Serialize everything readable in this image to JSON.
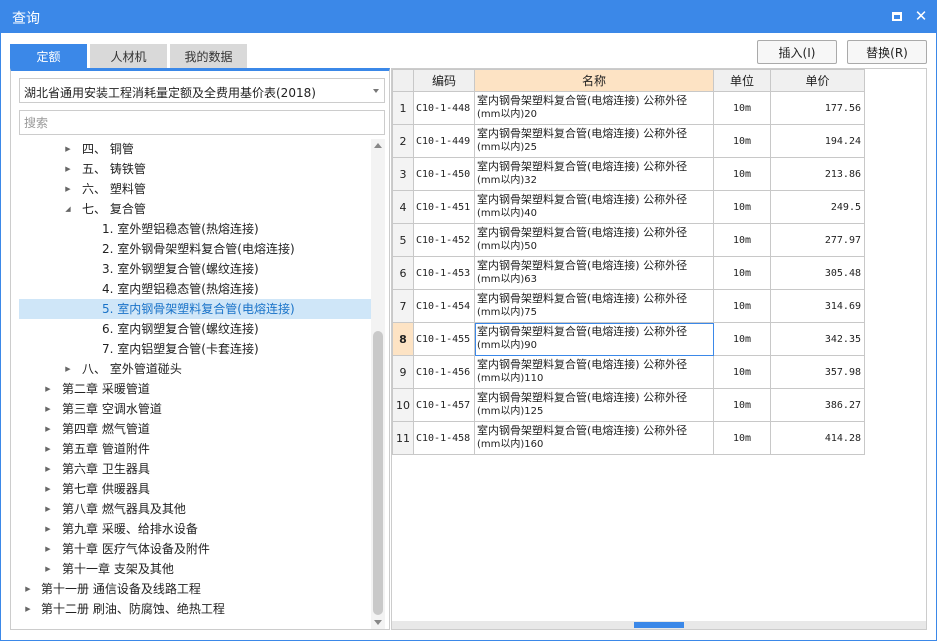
{
  "window": {
    "title": "查询"
  },
  "tabs": [
    {
      "label": "定额"
    },
    {
      "label": "人材机"
    },
    {
      "label": "我的数据"
    }
  ],
  "buttons": {
    "insert": "插入(I)",
    "replace": "替换(R)"
  },
  "left": {
    "library_select": "湖北省通用安装工程消耗量定额及全费用基价表(2018)",
    "search_placeholder": "搜索",
    "tree": [
      {
        "label": "四、 铜管",
        "level": 1,
        "expanded": false
      },
      {
        "label": "五、 铸铁管",
        "level": 1,
        "expanded": false
      },
      {
        "label": "六、 塑料管",
        "level": 1,
        "expanded": false
      },
      {
        "label": "七、 复合管",
        "level": 1,
        "expanded": true
      },
      {
        "label": "1. 室外塑铝稳态管(热熔连接)",
        "level": 2
      },
      {
        "label": "2. 室外钢骨架塑料复合管(电熔连接)",
        "level": 2
      },
      {
        "label": "3. 室外钢塑复合管(螺纹连接)",
        "level": 2
      },
      {
        "label": "4. 室内塑铝稳态管(热熔连接)",
        "level": 2
      },
      {
        "label": "5. 室内钢骨架塑料复合管(电熔连接)",
        "level": 2,
        "selected": true
      },
      {
        "label": "6. 室内钢塑复合管(螺纹连接)",
        "level": 2
      },
      {
        "label": "7. 室内铝塑复合管(卡套连接)",
        "level": 2
      },
      {
        "label": "八、 室外管道碰头",
        "level": 1,
        "expanded": false
      },
      {
        "label": "第二章 采暖管道",
        "level": 0,
        "expanded": false
      },
      {
        "label": "第三章 空调水管道",
        "level": 0,
        "expanded": false
      },
      {
        "label": "第四章 燃气管道",
        "level": 0,
        "expanded": false
      },
      {
        "label": "第五章 管道附件",
        "level": 0,
        "expanded": false
      },
      {
        "label": "第六章 卫生器具",
        "level": 0,
        "expanded": false
      },
      {
        "label": "第七章 供暖器具",
        "level": 0,
        "expanded": false
      },
      {
        "label": "第八章 燃气器具及其他",
        "level": 0,
        "expanded": false
      },
      {
        "label": "第九章 采暖、给排水设备",
        "level": 0,
        "expanded": false
      },
      {
        "label": "第十章 医疗气体设备及附件",
        "level": 0,
        "expanded": false
      },
      {
        "label": "第十一章 支架及其他",
        "level": 0,
        "expanded": false
      },
      {
        "label": "第十一册 通信设备及线路工程",
        "level": -1,
        "expanded": false
      },
      {
        "label": "第十二册 刷油、防腐蚀、绝热工程",
        "level": -1,
        "expanded": false
      }
    ]
  },
  "table": {
    "headers": {
      "code": "编码",
      "name": "名称",
      "unit": "单位",
      "price": "单价"
    },
    "active_row": 8,
    "rows": [
      {
        "idx": "1",
        "code": "C10-1-448",
        "name1": "室内钢骨架塑料复合管(电熔连接) 公称外径",
        "name2": "(mm以内)20",
        "unit": "10m",
        "price": "177.56"
      },
      {
        "idx": "2",
        "code": "C10-1-449",
        "name1": "室内钢骨架塑料复合管(电熔连接) 公称外径",
        "name2": "(mm以内)25",
        "unit": "10m",
        "price": "194.24"
      },
      {
        "idx": "3",
        "code": "C10-1-450",
        "name1": "室内钢骨架塑料复合管(电熔连接) 公称外径",
        "name2": "(mm以内)32",
        "unit": "10m",
        "price": "213.86"
      },
      {
        "idx": "4",
        "code": "C10-1-451",
        "name1": "室内钢骨架塑料复合管(电熔连接) 公称外径",
        "name2": "(mm以内)40",
        "unit": "10m",
        "price": "249.5"
      },
      {
        "idx": "5",
        "code": "C10-1-452",
        "name1": "室内钢骨架塑料复合管(电熔连接) 公称外径",
        "name2": "(mm以内)50",
        "unit": "10m",
        "price": "277.97"
      },
      {
        "idx": "6",
        "code": "C10-1-453",
        "name1": "室内钢骨架塑料复合管(电熔连接) 公称外径",
        "name2": "(mm以内)63",
        "unit": "10m",
        "price": "305.48"
      },
      {
        "idx": "7",
        "code": "C10-1-454",
        "name1": "室内钢骨架塑料复合管(电熔连接) 公称外径",
        "name2": "(mm以内)75",
        "unit": "10m",
        "price": "314.69"
      },
      {
        "idx": "8",
        "code": "C10-1-455",
        "name1": "室内钢骨架塑料复合管(电熔连接) 公称外径",
        "name2": "(mm以内)90",
        "unit": "10m",
        "price": "342.35"
      },
      {
        "idx": "9",
        "code": "C10-1-456",
        "name1": "室内钢骨架塑料复合管(电熔连接) 公称外径",
        "name2": "(mm以内)110",
        "unit": "10m",
        "price": "357.98"
      },
      {
        "idx": "10",
        "code": "C10-1-457",
        "name1": "室内钢骨架塑料复合管(电熔连接) 公称外径",
        "name2": "(mm以内)125",
        "unit": "10m",
        "price": "386.27"
      },
      {
        "idx": "11",
        "code": "C10-1-458",
        "name1": "室内钢骨架塑料复合管(电熔连接) 公称外径",
        "name2": "(mm以内)160",
        "unit": "10m",
        "price": "414.28"
      }
    ]
  },
  "colors": {
    "accent": "#3b88e8",
    "header_highlight": "#fde3c4",
    "tree_selected": "#cfe6f8"
  },
  "icons": {
    "maximize": "maximize-icon",
    "close": "close-icon",
    "dropdown": "chevron-down-icon",
    "expand": "triangle-right-icon",
    "collapse": "triangle-down-icon"
  }
}
